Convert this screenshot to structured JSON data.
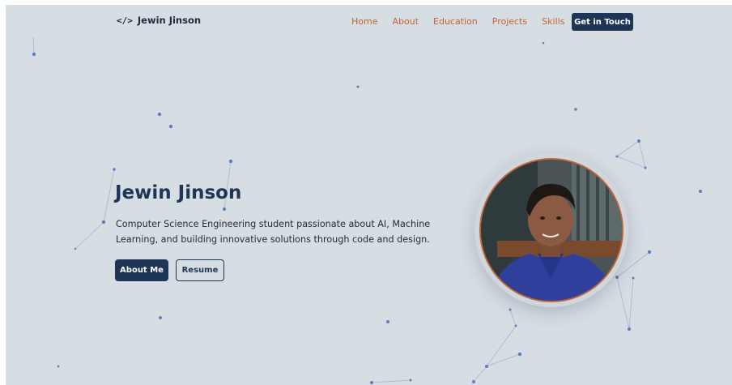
{
  "nav": {
    "logo_symbol": "</>",
    "logo_text": "Jewin Jinson",
    "links": [
      {
        "label": "Home"
      },
      {
        "label": "About"
      },
      {
        "label": "Education"
      },
      {
        "label": "Projects"
      },
      {
        "label": "Skills"
      }
    ],
    "cta_label": "Get in Touch"
  },
  "hero": {
    "title": "Jewin Jinson",
    "description": "Computer Science Engineering student passionate about AI, Machine Learning, and building innovative solutions through code and design.",
    "primary_button": "About Me",
    "secondary_button": "Resume"
  },
  "colors": {
    "background": "#d6dde3",
    "accent": "#c0643a",
    "primary": "#1f3556",
    "particle": "#5c7fb5"
  },
  "icons": {
    "logo": "code-brackets-icon",
    "photo": "profile-photo"
  }
}
